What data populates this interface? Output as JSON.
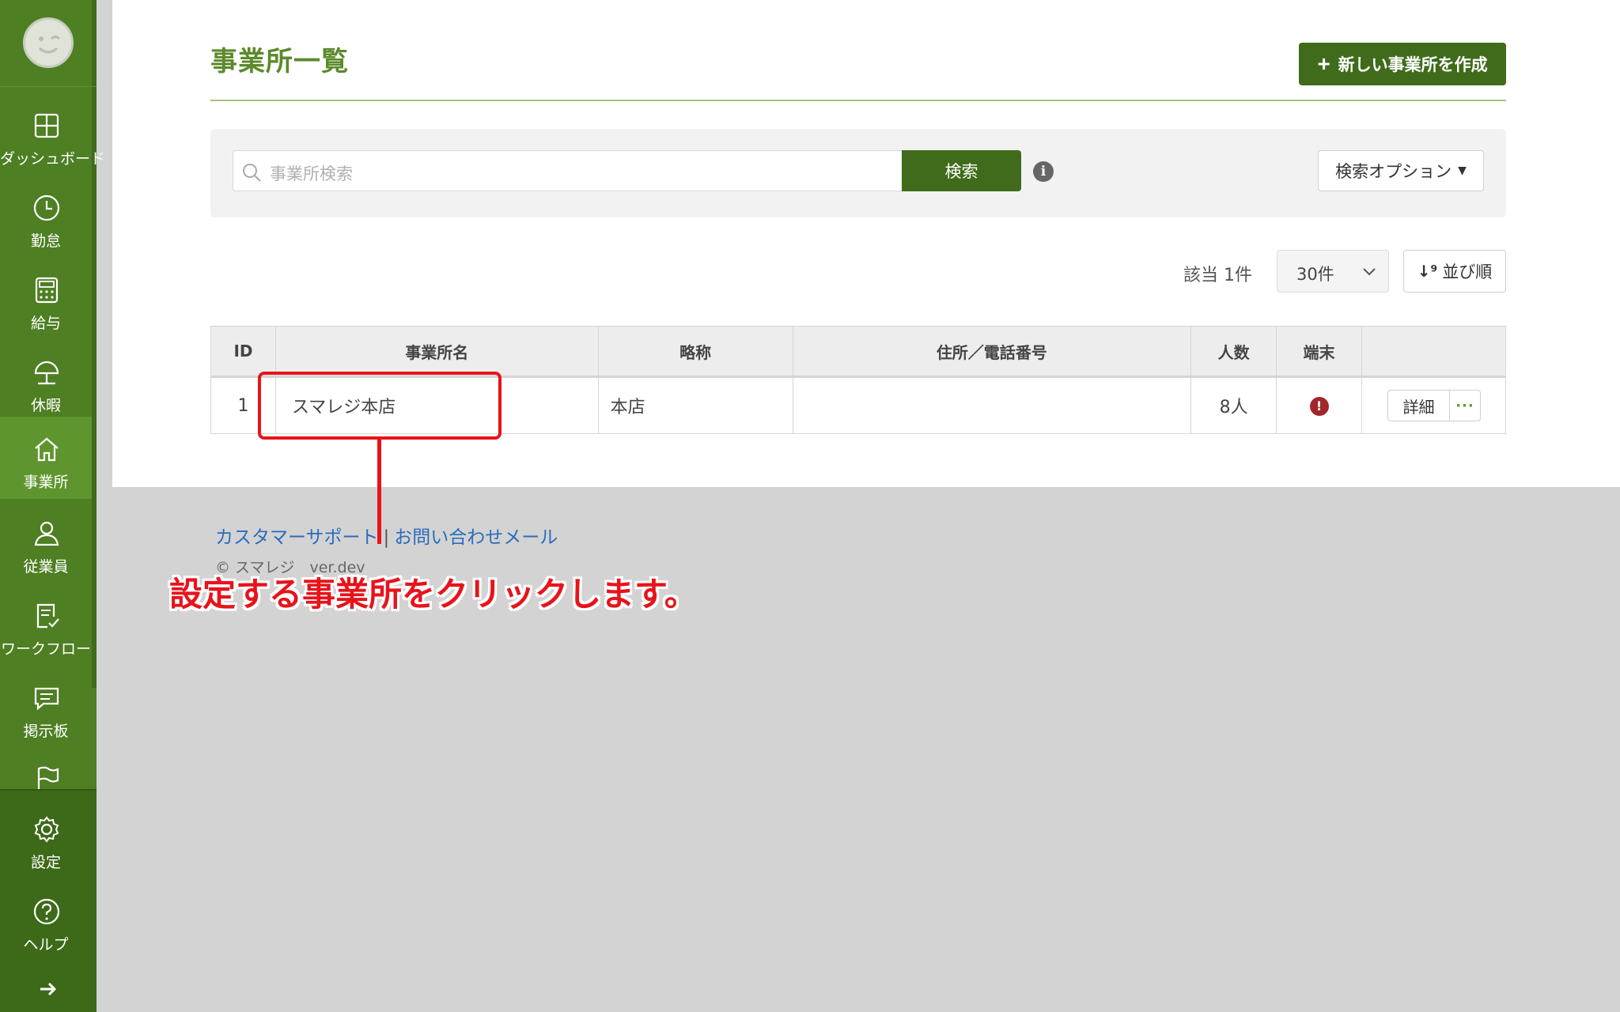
{
  "sidebar": {
    "items": [
      {
        "label": "ダッシュボード",
        "icon": "dashboard-icon"
      },
      {
        "label": "勤怠",
        "icon": "clock-icon"
      },
      {
        "label": "給与",
        "icon": "calculator-icon"
      },
      {
        "label": "休暇",
        "icon": "umbrella-icon"
      },
      {
        "label": "事業所",
        "icon": "home-icon",
        "active": true
      },
      {
        "label": "従業員",
        "icon": "person-icon"
      },
      {
        "label": "ワークフロー",
        "icon": "checklist-icon"
      },
      {
        "label": "掲示板",
        "icon": "message-icon"
      },
      {
        "label": "",
        "icon": "flag-icon"
      }
    ],
    "bottom_items": [
      {
        "label": "設定",
        "icon": "gear-icon"
      },
      {
        "label": "ヘルプ",
        "icon": "help-icon"
      }
    ]
  },
  "header": {
    "title": "事業所一覧",
    "create_button": "新しい事業所を作成"
  },
  "search": {
    "placeholder": "事業所検索",
    "button": "検索",
    "options_button": "検索オプション"
  },
  "list_controls": {
    "count": "該当 1件",
    "per_page": "30件",
    "sort_button": "並び順"
  },
  "table": {
    "headers": [
      "ID",
      "事業所名",
      "略称",
      "住所／電話番号",
      "人数",
      "端末",
      ""
    ],
    "rows": [
      {
        "id": "1",
        "name": "スマレジ本店",
        "abbr": "本店",
        "address": "",
        "people": "8人",
        "terminal": "!",
        "detail": "詳細",
        "more": "···"
      }
    ]
  },
  "footer": {
    "support_link": "カスタマーサポート",
    "separator": "|",
    "mail_link": "お問い合わせメール",
    "copyright": "© スマレジ　ver.dev"
  },
  "annotation": {
    "text": "設定する事業所をクリックします。"
  },
  "colors": {
    "sidebar": "#4e7f23",
    "primary_button": "#3f6b1a",
    "title_green": "#5b8a2b",
    "link_blue": "#2a6cbd",
    "annotation_red": "#e8131b"
  }
}
